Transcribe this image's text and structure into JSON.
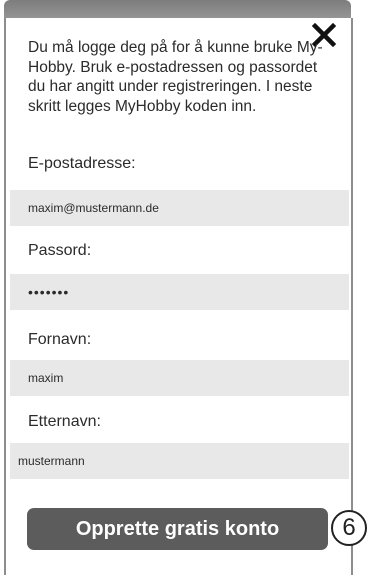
{
  "dialog": {
    "intro_text": "Du må logge deg på for å kunne bruke My-Hobby. Bruk e-postadressen og passordet du har angitt under registreringen. I neste skritt legges MyHobby koden inn."
  },
  "form": {
    "email": {
      "label": "E-postadresse:",
      "value": "maxim@mustermann.de"
    },
    "password": {
      "label": "Passord:",
      "value": "•••••••"
    },
    "first_name": {
      "label": "Fornavn:",
      "value": "maxim"
    },
    "last_name": {
      "label": "Etternavn:",
      "value": "mustermann"
    },
    "submit_label": "Opprette gratis konto"
  },
  "annotation": {
    "callout_number": "6"
  },
  "icons": {
    "close": "close-icon"
  }
}
